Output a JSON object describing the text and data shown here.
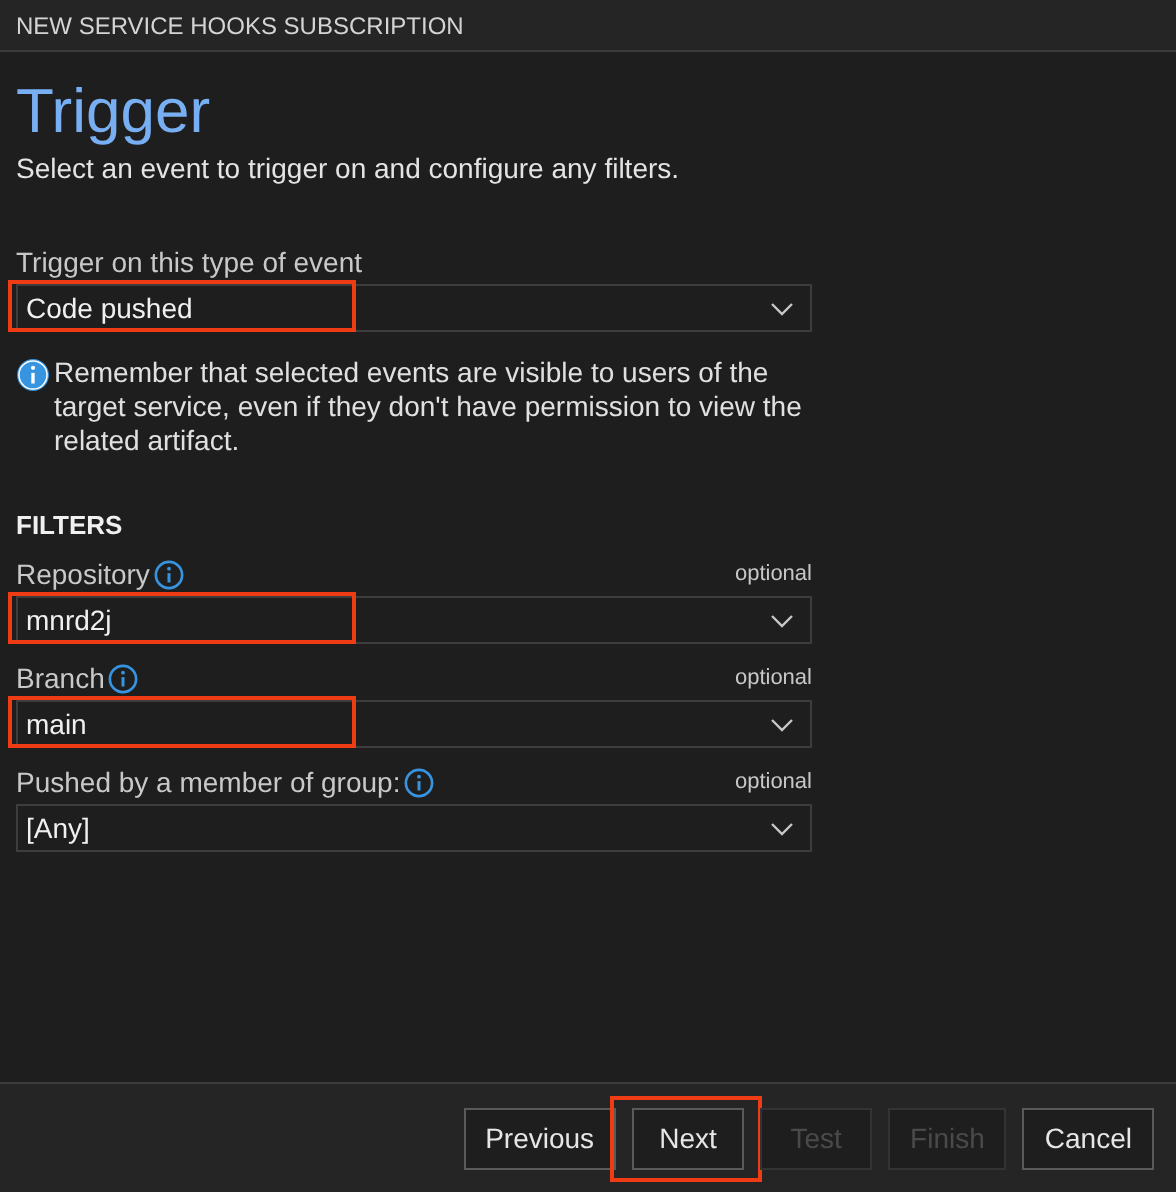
{
  "window": {
    "title": "NEW SERVICE HOOKS SUBSCRIPTION"
  },
  "heading": "Trigger",
  "subtitle": "Select an event to trigger on and configure any filters.",
  "event_field": {
    "label": "Trigger on this type of event",
    "value": "Code pushed",
    "highlighted": true
  },
  "note": "Remember that selected events are visible to users of the target service, even if they don't have permission to view the related artifact.",
  "filters": {
    "title": "FILTERS",
    "fields": [
      {
        "label": "Repository",
        "hint": "optional",
        "value": "mnrd2j",
        "highlighted": true
      },
      {
        "label": "Branch",
        "hint": "optional",
        "value": "main",
        "highlighted": true
      },
      {
        "label": "Pushed by a member of group:",
        "hint": "optional",
        "value": "[Any]",
        "highlighted": false
      }
    ]
  },
  "buttons": [
    {
      "label": "Previous",
      "disabled": false,
      "highlighted": false
    },
    {
      "label": "Next",
      "disabled": false,
      "highlighted": true
    },
    {
      "label": "Test",
      "disabled": true,
      "highlighted": false
    },
    {
      "label": "Finish",
      "disabled": true,
      "highlighted": false
    },
    {
      "label": "Cancel",
      "disabled": false,
      "highlighted": false
    }
  ]
}
